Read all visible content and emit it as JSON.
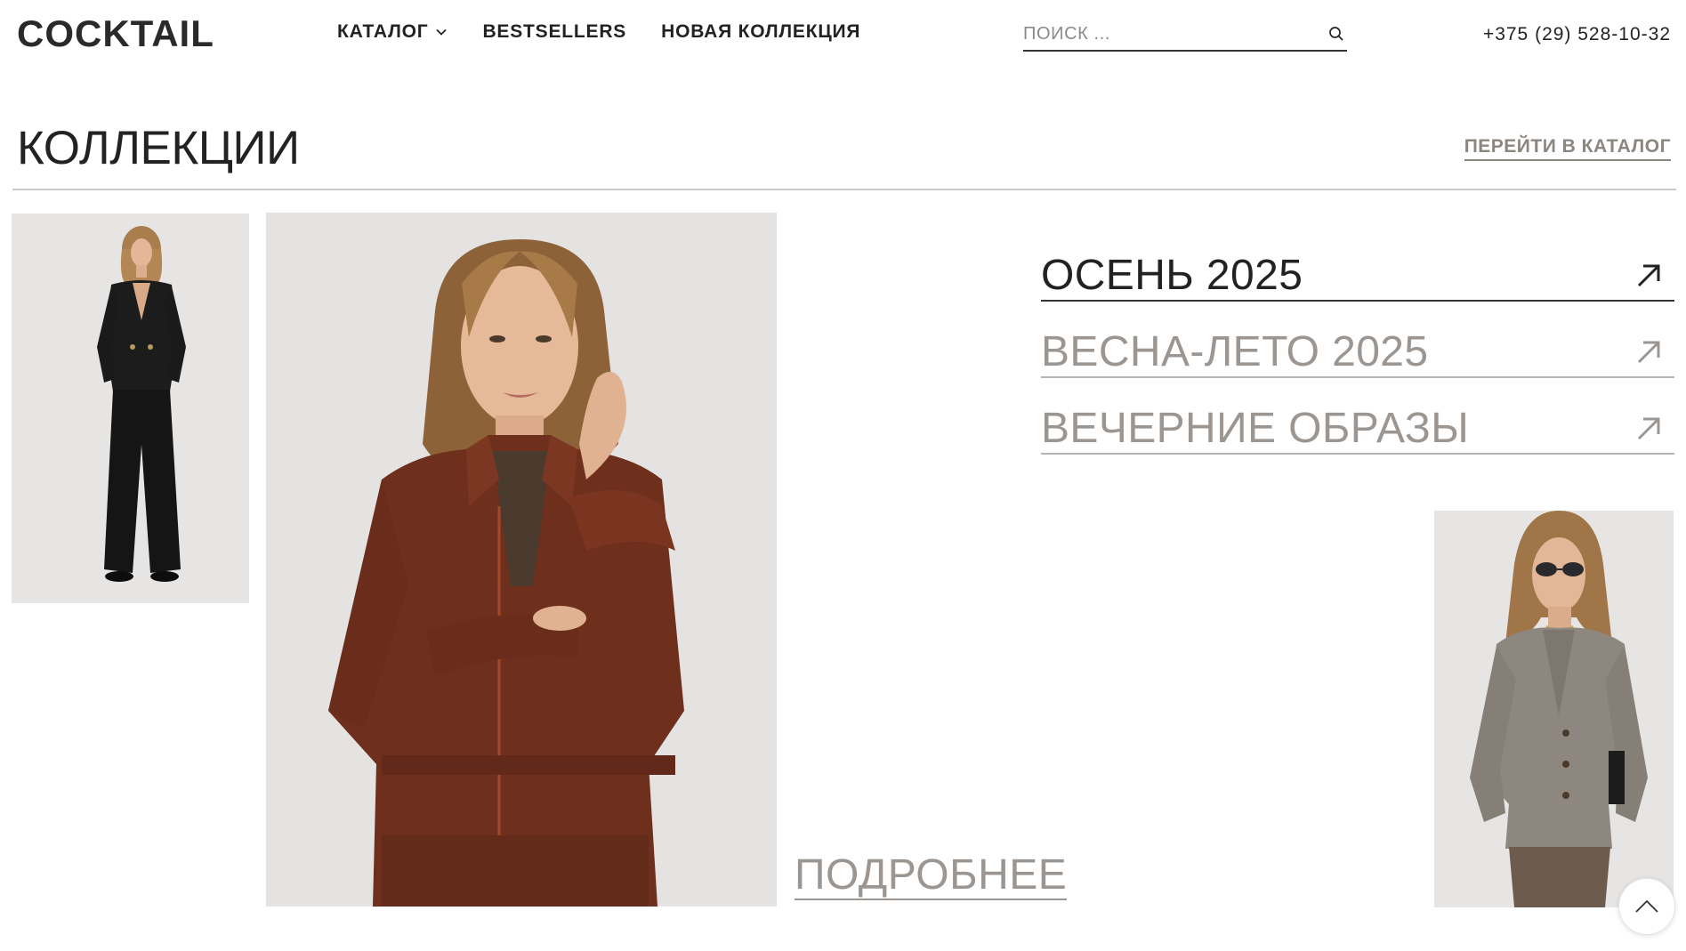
{
  "header": {
    "logo": "COCKTAIL",
    "nav": [
      {
        "label": "КАТАЛОГ",
        "has_dropdown": true
      },
      {
        "label": "BESTSELLERS"
      },
      {
        "label": "НОВАЯ КОЛЛЕКЦИЯ"
      }
    ],
    "search": {
      "placeholder": "ПОИСК ...",
      "value": ""
    },
    "phone": "+375 (29) 528-10-32"
  },
  "section": {
    "title": "КОЛЛЕКЦИИ",
    "catalog_link": "ПЕРЕЙТИ В КАТАЛОГ"
  },
  "collections": [
    {
      "label": "ОСЕНЬ 2025",
      "active": true,
      "icon": "arrow-up-right-icon"
    },
    {
      "label": "ВЕСНА-ЛЕТО 2025",
      "active": false,
      "icon": "arrow-up-right-icon"
    },
    {
      "label": "ВЕЧЕРНИЕ ОБРАЗЫ",
      "active": false,
      "icon": "arrow-up-right-icon"
    }
  ],
  "more_link": "ПОДРОБНЕЕ",
  "icons": {
    "catalog_dropdown": "chevron-down-icon",
    "search": "search-icon",
    "scroll_top": "chevron-up-icon"
  },
  "colors": {
    "text_dark": "#222222",
    "text_muted": "#9b9692",
    "catalog_link": "#8c8680",
    "photo_background": "#e6e5e4",
    "jacket_brown": "#6e2f1c",
    "black_outfit": "#1a1a1a",
    "grey_blazer": "#8d877f"
  }
}
